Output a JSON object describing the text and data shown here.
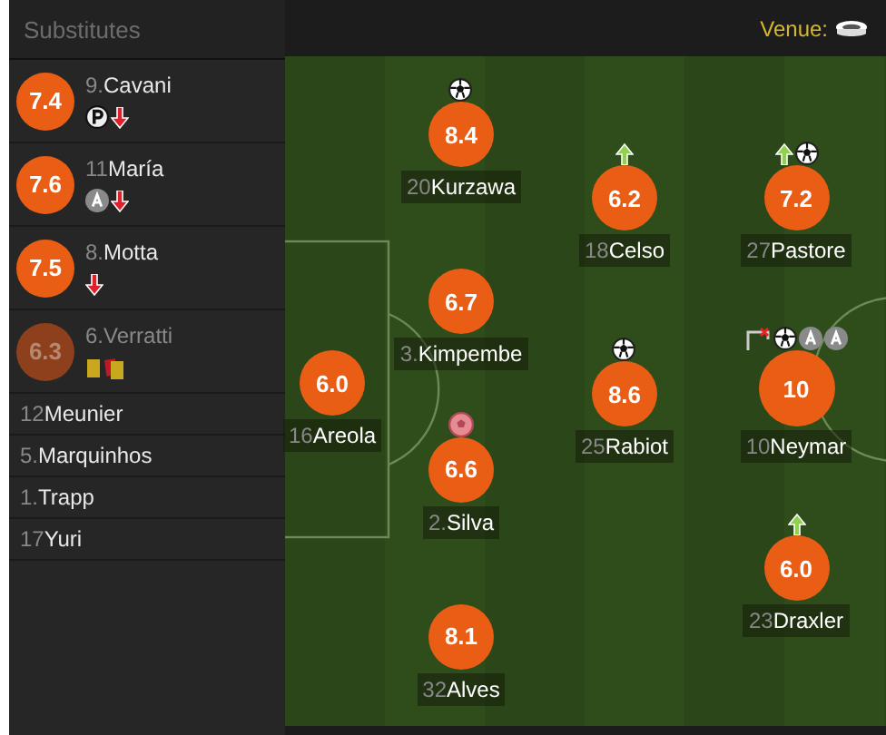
{
  "substitutes": {
    "title": "Substitutes",
    "players": [
      {
        "number": "9.",
        "name": "Cavani",
        "rating": "7.4",
        "dimmed": false,
        "events": [
          {
            "kind": "penalty_goal"
          },
          {
            "kind": "sub_out"
          }
        ]
      },
      {
        "number": "11",
        "name": "María",
        "rating": "7.6",
        "dimmed": false,
        "events": [
          {
            "kind": "assist"
          },
          {
            "kind": "sub_out"
          }
        ]
      },
      {
        "number": "8.",
        "name": "Motta",
        "rating": "7.5",
        "dimmed": false,
        "events": [
          {
            "kind": "sub_out"
          }
        ]
      },
      {
        "number": "6.",
        "name": "Verratti",
        "rating": "6.3",
        "dimmed": true,
        "events": [
          {
            "kind": "yellow_card"
          },
          {
            "kind": "second_yellow"
          }
        ]
      },
      {
        "number": "12",
        "name": "Meunier",
        "dimmed": false
      },
      {
        "number": "5.",
        "name": "Marquinhos",
        "dimmed": false
      },
      {
        "number": "1.",
        "name": "Trapp",
        "dimmed": false
      },
      {
        "number": "17",
        "name": "Yuri",
        "dimmed": false
      }
    ]
  },
  "pitch": {
    "venue_label": "Venue:",
    "lines": [
      {
        "players": [
          {
            "number": "16",
            "name": "Areola",
            "rating": "6.0"
          }
        ]
      },
      {
        "players": [
          {
            "number": "20",
            "name": "Kurzawa",
            "rating": "8.4",
            "events": [
              {
                "kind": "goal"
              }
            ]
          },
          {
            "number": "3.",
            "name": "Kimpembe",
            "rating": "6.7"
          },
          {
            "number": "2.",
            "name": "Silva",
            "rating": "6.6",
            "events": [
              {
                "kind": "own_goal"
              }
            ]
          },
          {
            "number": "32",
            "name": "Alves",
            "rating": "8.1"
          }
        ]
      },
      {
        "players": [
          {
            "number": "18",
            "name": "Celso",
            "rating": "6.2",
            "events": [
              {
                "kind": "sub_in"
              }
            ]
          },
          {
            "number": "25",
            "name": "Rabiot",
            "rating": "8.6",
            "events": [
              {
                "kind": "goal"
              }
            ]
          }
        ]
      },
      {
        "players": [
          {
            "number": "27",
            "name": "Pastore",
            "rating": "7.2",
            "events": [
              {
                "kind": "sub_in"
              },
              {
                "kind": "goal"
              }
            ]
          },
          {
            "number": "10",
            "name": "Neymar",
            "rating": "10",
            "events": [
              {
                "kind": "woodwork"
              },
              {
                "kind": "goal"
              },
              {
                "kind": "assist"
              },
              {
                "kind": "assist"
              }
            ]
          },
          {
            "number": "23",
            "name": "Draxler",
            "rating": "6.0",
            "events": [
              {
                "kind": "sub_in"
              }
            ]
          }
        ]
      }
    ]
  }
}
